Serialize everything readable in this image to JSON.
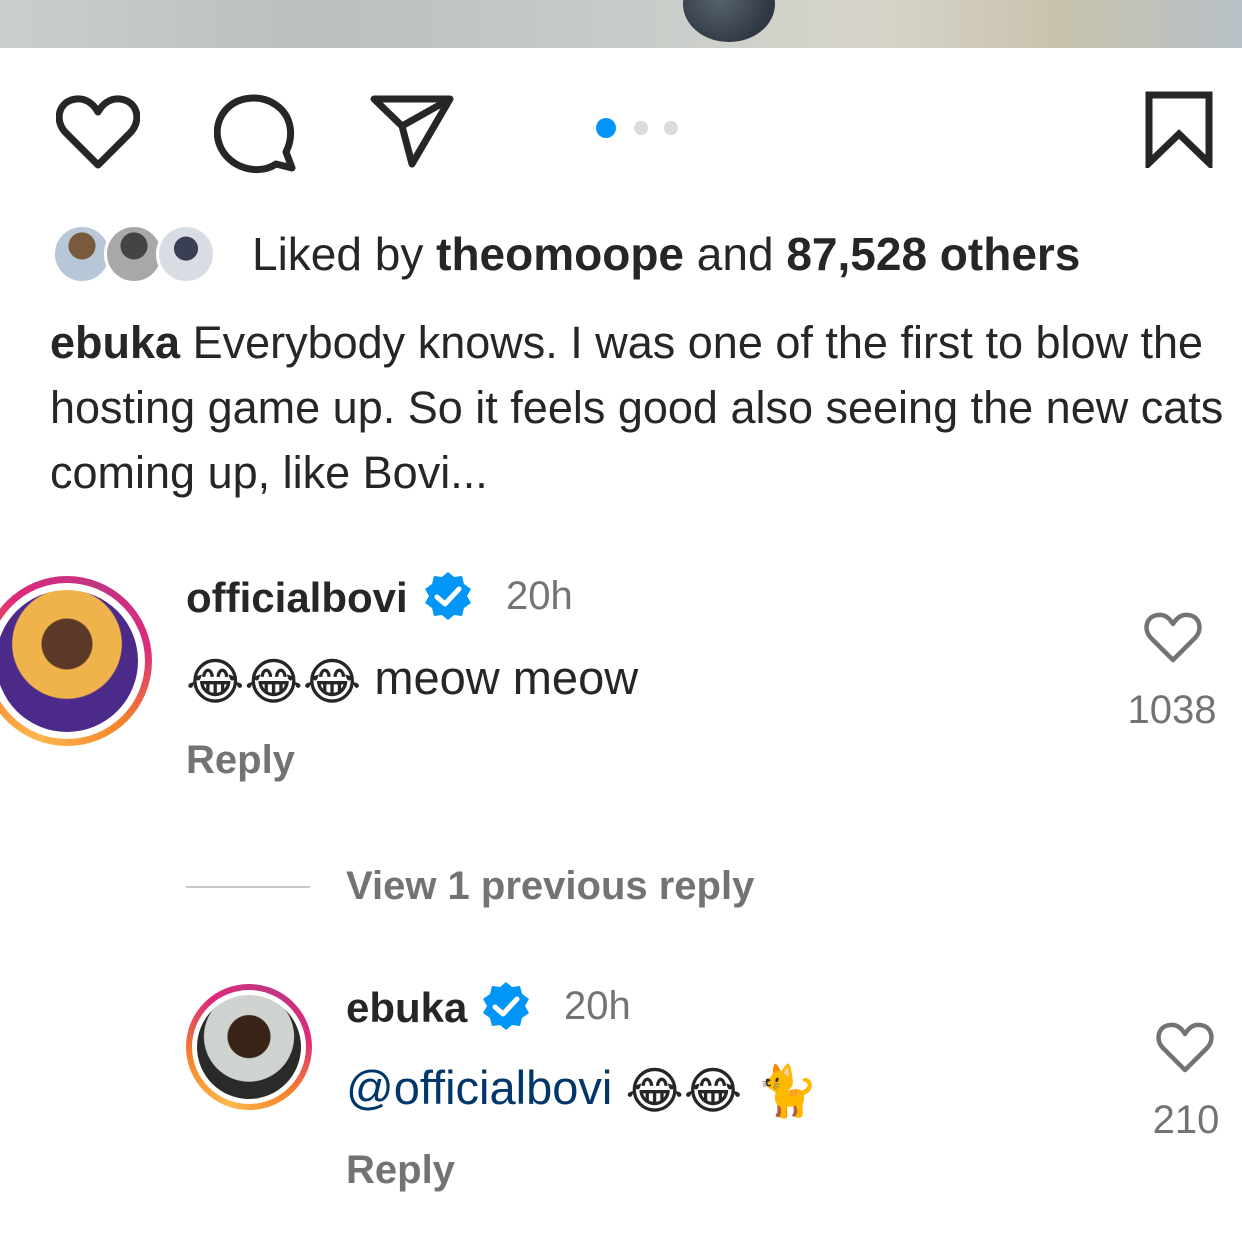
{
  "post": {
    "icons": {
      "like": "heart-outline-icon",
      "comment": "comment-bubble-icon",
      "share": "paper-plane-icon",
      "save": "bookmark-icon"
    },
    "carousel": {
      "count": 3,
      "active_index": 0,
      "active_color": "#0095f6",
      "inactive_color": "#dbdbdb"
    },
    "likes": {
      "prefix": "Liked by",
      "user": "theomoope",
      "conjunction": "and",
      "others": "87,528 others"
    },
    "caption": {
      "username": "ebuka",
      "text": "Everybody knows. I was one of the first to blow the hosting game up. So it feels good also seeing the new cats coming up, like Bovi..."
    }
  },
  "comments": [
    {
      "username": "officialbovi",
      "verified": true,
      "time": "20h",
      "emojis": "😂😂😂",
      "text": "meow meow",
      "reply_label": "Reply",
      "like_count": "1038"
    }
  ],
  "view_previous": "View 1 previous reply",
  "replies": [
    {
      "username": "ebuka",
      "verified": true,
      "time": "20h",
      "mention": "@officialbovi",
      "emojis": "😂😂 🐈",
      "reply_label": "Reply",
      "like_count": "210"
    }
  ],
  "colors": {
    "verified_blue": "#0095f6",
    "mention": "#00376b",
    "muted_text": "#737373"
  }
}
